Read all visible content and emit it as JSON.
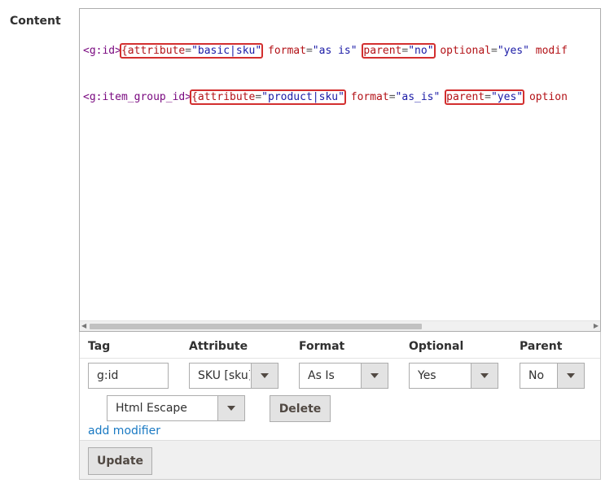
{
  "field": {
    "label": "Content"
  },
  "code": {
    "line1": {
      "tag": "<g:id>",
      "parts": [
        {
          "a": "{attribute",
          "v": "\"basic|sku\""
        },
        {
          "a": "format",
          "v": "\"as is\""
        },
        {
          "a": "parent",
          "v": "\"no\""
        },
        {
          "a": "optional",
          "v": "\"yes\""
        },
        {
          "a": "modif",
          "v": ""
        }
      ]
    },
    "line2": {
      "tag": "<g:item_group_id>",
      "parts": [
        {
          "a": "{attribute",
          "v": "\"product|sku\""
        },
        {
          "a": "format",
          "v": "\"as_is\""
        },
        {
          "a": "parent",
          "v": "\"yes\""
        },
        {
          "a": "option",
          "v": ""
        }
      ]
    },
    "eq": "="
  },
  "row_editor": {
    "headers": {
      "tag": "Tag",
      "attribute": "Attribute",
      "format": "Format",
      "optional": "Optional",
      "parent": "Parent"
    },
    "tag_value": "g:id",
    "attribute_value": "SKU [sku]",
    "format_value": "As Is",
    "optional_value": "Yes",
    "parent_value": "No",
    "modifier_value": "Html Escape",
    "delete_label": "Delete",
    "add_modifier_label": "add modifier",
    "update_label": "Update"
  },
  "colors": {
    "highlight": "#d32f2f",
    "link": "#1979c3"
  }
}
